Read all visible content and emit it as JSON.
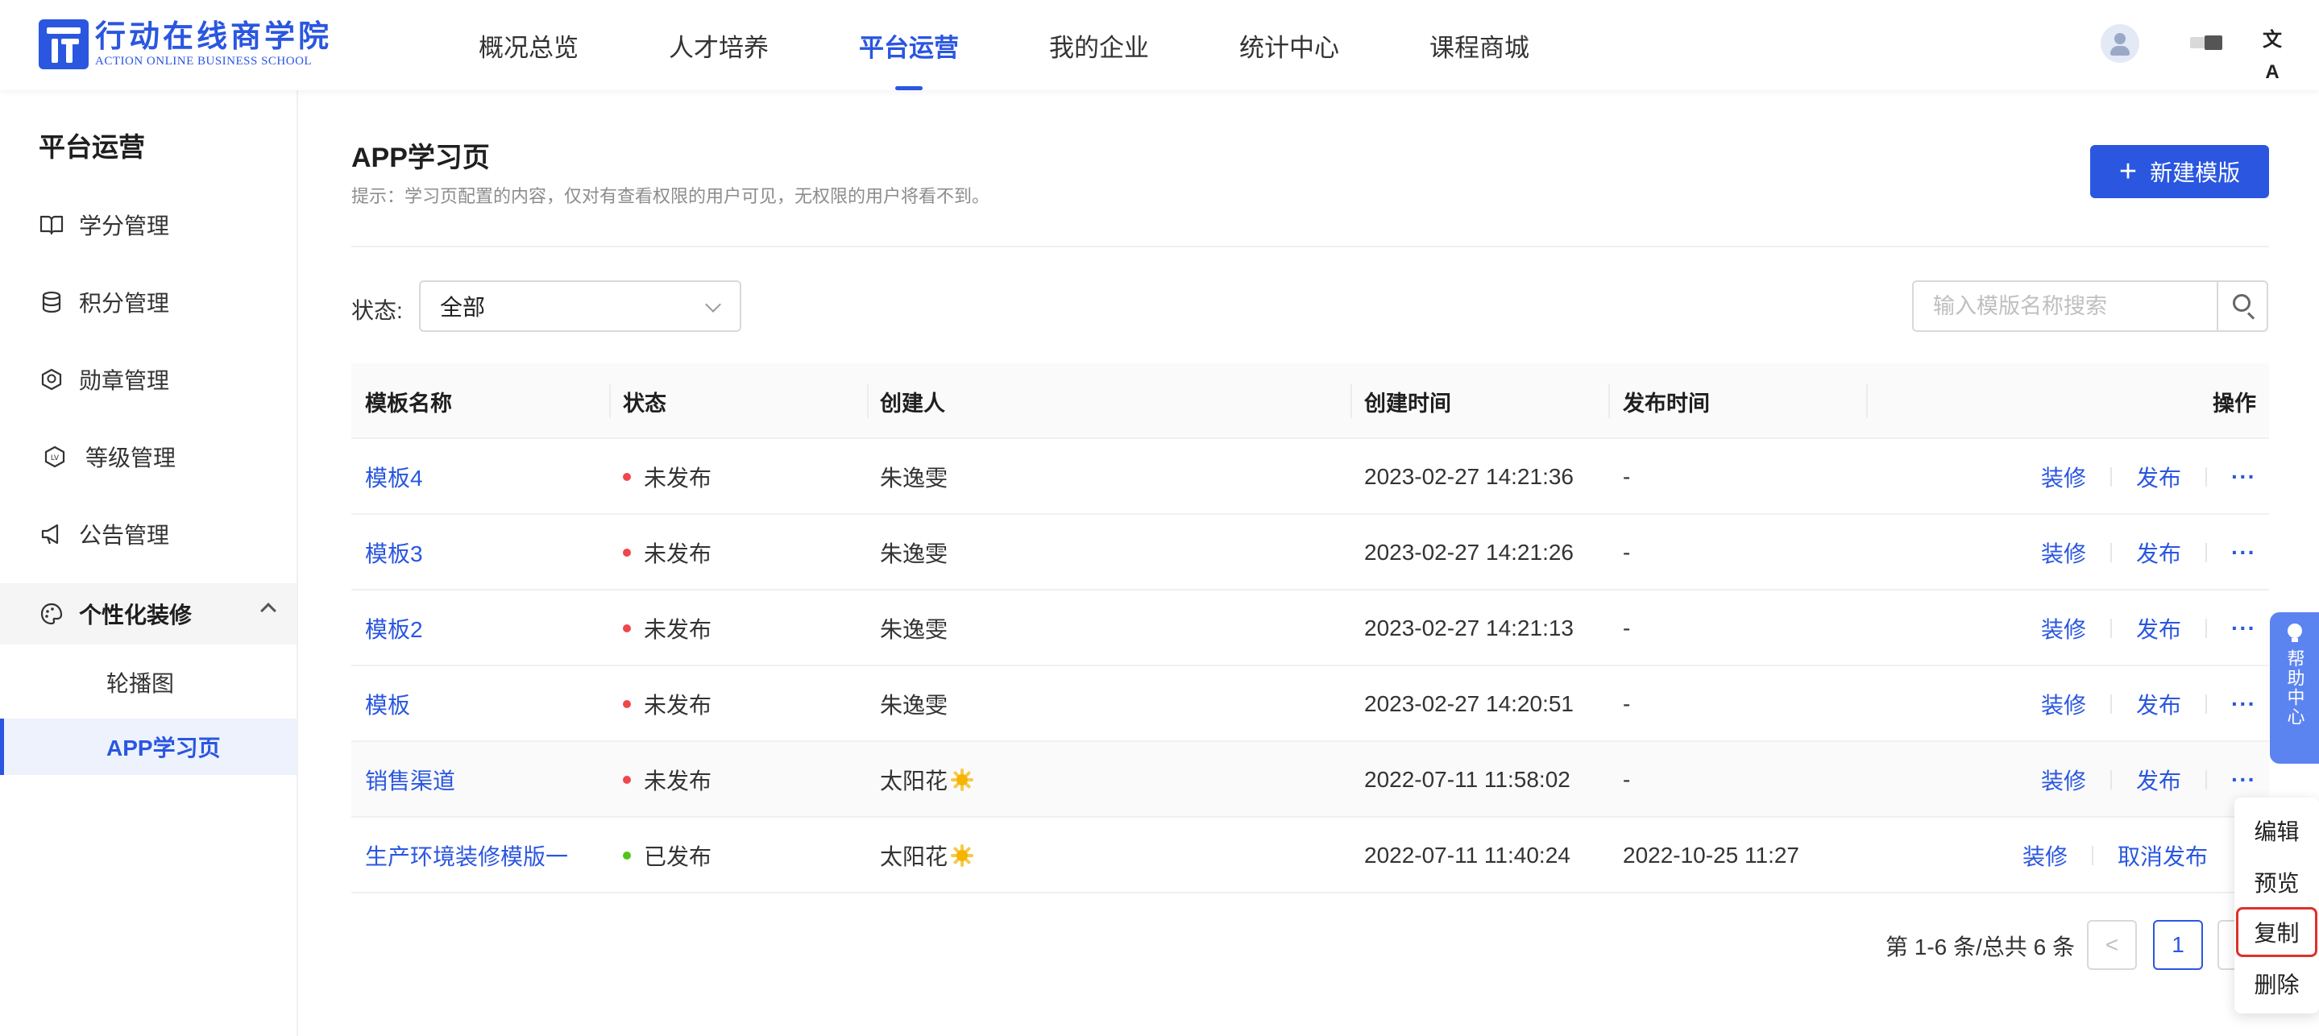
{
  "header": {
    "logo_cn": "行动在线商学院",
    "logo_en": "ACTION ONLINE BUSINESS SCHOOL",
    "nav": [
      "概况总览",
      "人才培养",
      "平台运营",
      "我的企业",
      "统计中心",
      "课程商城"
    ],
    "active_nav": "平台运营",
    "lang_icon": "文A"
  },
  "sidebar": {
    "title": "平台运营",
    "items": [
      {
        "label": "学分管理",
        "icon": "book-icon"
      },
      {
        "label": "积分管理",
        "icon": "coins-icon"
      },
      {
        "label": "勋章管理",
        "icon": "medal-icon"
      },
      {
        "label": "等级管理",
        "icon": "level-icon"
      },
      {
        "label": "公告管理",
        "icon": "megaphone-icon"
      },
      {
        "label": "个性化装修",
        "icon": "palette-icon"
      }
    ],
    "subitems": [
      "轮播图",
      "APP学习页"
    ],
    "active_sub": "APP学习页"
  },
  "main": {
    "title": "APP学习页",
    "hint": "提示：学习页配置的内容，仅对有查看权限的用户可见，无权限的用户将看不到。",
    "new_button": "新建模版",
    "filter_label": "状态:",
    "filter_value": "全部",
    "search_placeholder": "输入模版名称搜索"
  },
  "table": {
    "columns": [
      "模板名称",
      "状态",
      "创建人",
      "创建时间",
      "发布时间",
      "操作"
    ],
    "rows": [
      {
        "name": "模板4",
        "status": "未发布",
        "creator": "朱逸雯",
        "created": "2023-02-27 14:21:36",
        "published": "-",
        "action1": "装修",
        "action2": "发布",
        "more": "···"
      },
      {
        "name": "模板3",
        "status": "未发布",
        "creator": "朱逸雯",
        "created": "2023-02-27 14:21:26",
        "published": "-",
        "action1": "装修",
        "action2": "发布",
        "more": "···"
      },
      {
        "name": "模板2",
        "status": "未发布",
        "creator": "朱逸雯",
        "created": "2023-02-27 14:21:13",
        "published": "-",
        "action1": "装修",
        "action2": "发布",
        "more": "···"
      },
      {
        "name": "模板",
        "status": "未发布",
        "creator": "朱逸雯",
        "created": "2023-02-27 14:20:51",
        "published": "-",
        "action1": "装修",
        "action2": "发布",
        "more": "···"
      },
      {
        "name": "销售渠道",
        "status": "未发布",
        "creator": "太阳花",
        "created": "2022-07-11 11:58:02",
        "published": "-",
        "action1": "装修",
        "action2": "发布",
        "more": "···"
      },
      {
        "name": "生产环境装修模版一",
        "status": "已发布",
        "creator": "太阳花",
        "created": "2022-07-11 11:40:24",
        "published": "2022-10-25 11:27",
        "action1": "装修",
        "action2": "取消发布",
        "more": ""
      }
    ],
    "status_colors": {
      "未发布": "#f0474b",
      "已发布": "#52c41a"
    }
  },
  "pagination": {
    "summary": "第 1-6 条/总共 6 条",
    "prev": "<",
    "current_page": "1"
  },
  "help": {
    "label": "帮助中心"
  },
  "dropdown": {
    "items": [
      "编辑",
      "预览",
      "复制",
      "删除"
    ],
    "highlighted": "复制"
  },
  "colors": {
    "accent": "#2a56e0",
    "highlight_border": "#e0302a"
  }
}
